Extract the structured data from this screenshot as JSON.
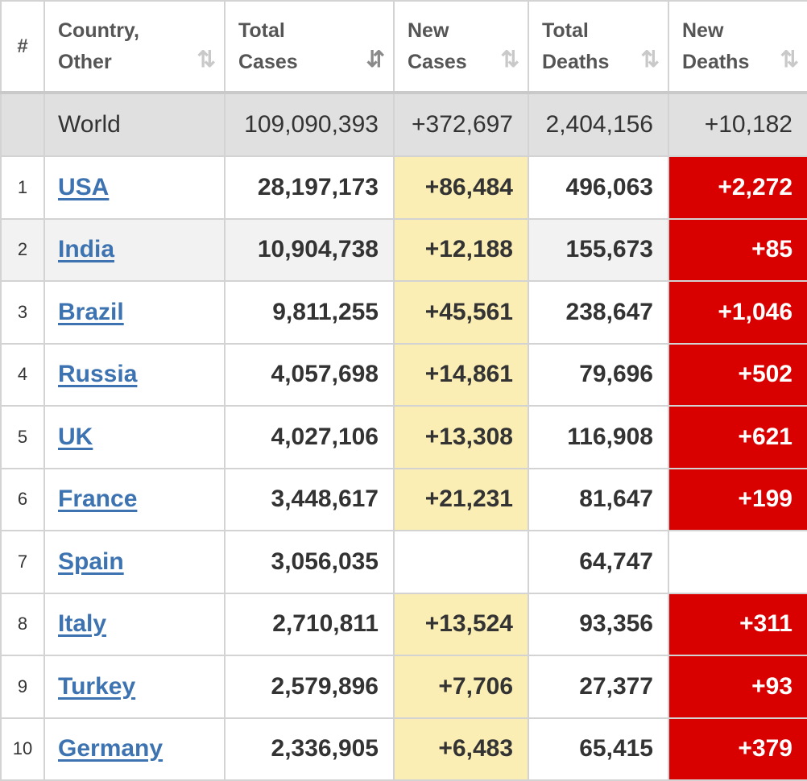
{
  "headers": {
    "index": "#",
    "country_line1": "Country,",
    "country_line2": "Other",
    "total_cases_line1": "Total",
    "total_cases_line2": "Cases",
    "new_cases_line1": "New",
    "new_cases_line2": "Cases",
    "total_deaths_line1": "Total",
    "total_deaths_line2": "Deaths",
    "new_deaths_line1": "New",
    "new_deaths_line2": "Deaths",
    "sort_icon": "⇅",
    "sort_active_icon": "⇵"
  },
  "world": {
    "name": "World",
    "total_cases": "109,090,393",
    "new_cases": "+372,697",
    "total_deaths": "2,404,156",
    "new_deaths": "+10,182"
  },
  "rows": [
    {
      "idx": "1",
      "country": "USA",
      "total_cases": "28,197,173",
      "new_cases": "+86,484",
      "total_deaths": "496,063",
      "new_deaths": "+2,272"
    },
    {
      "idx": "2",
      "country": "India",
      "total_cases": "10,904,738",
      "new_cases": "+12,188",
      "total_deaths": "155,673",
      "new_deaths": "+85"
    },
    {
      "idx": "3",
      "country": "Brazil",
      "total_cases": "9,811,255",
      "new_cases": "+45,561",
      "total_deaths": "238,647",
      "new_deaths": "+1,046"
    },
    {
      "idx": "4",
      "country": "Russia",
      "total_cases": "4,057,698",
      "new_cases": "+14,861",
      "total_deaths": "79,696",
      "new_deaths": "+502"
    },
    {
      "idx": "5",
      "country": "UK",
      "total_cases": "4,027,106",
      "new_cases": "+13,308",
      "total_deaths": "116,908",
      "new_deaths": "+621"
    },
    {
      "idx": "6",
      "country": "France",
      "total_cases": "3,448,617",
      "new_cases": "+21,231",
      "total_deaths": "81,647",
      "new_deaths": "+199"
    },
    {
      "idx": "7",
      "country": "Spain",
      "total_cases": "3,056,035",
      "new_cases": "",
      "total_deaths": "64,747",
      "new_deaths": ""
    },
    {
      "idx": "8",
      "country": "Italy",
      "total_cases": "2,710,811",
      "new_cases": "+13,524",
      "total_deaths": "93,356",
      "new_deaths": "+311"
    },
    {
      "idx": "9",
      "country": "Turkey",
      "total_cases": "2,579,896",
      "new_cases": "+7,706",
      "total_deaths": "27,377",
      "new_deaths": "+93"
    },
    {
      "idx": "10",
      "country": "Germany",
      "total_cases": "2,336,905",
      "new_cases": "+6,483",
      "total_deaths": "65,415",
      "new_deaths": "+379"
    }
  ],
  "colors": {
    "new_cases_highlight": "#fbeeb4",
    "new_deaths_highlight": "#d90000",
    "link": "#3d73b0",
    "world_row": "#e0e0e0"
  }
}
